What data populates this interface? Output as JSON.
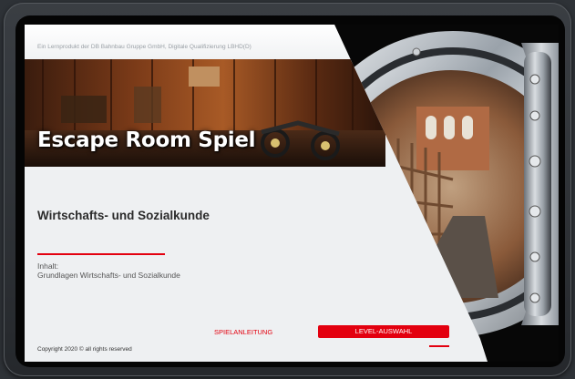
{
  "header": {
    "credit": "Ein Lernprodukt der DB Bahnbau Gruppe GmbH, Digitale Qualifizierung LBHD(D)"
  },
  "banner": {
    "title": "Escape Room Spiel"
  },
  "main": {
    "subject": "Wirtschafts- und Sozialkunde",
    "content_label": "Inhalt:",
    "content_text": "Grundlagen Wirtschafts- und Sozialkunde"
  },
  "actions": {
    "guide_label": "SPIELANLEITUNG",
    "level_label": "LEVEL-AUSWAHL"
  },
  "footer": {
    "copyright": "Copyright 2020 © all rights reserved"
  },
  "colors": {
    "accent": "#e3000f",
    "panel": "#eef0f2",
    "device": "#2e3237"
  }
}
